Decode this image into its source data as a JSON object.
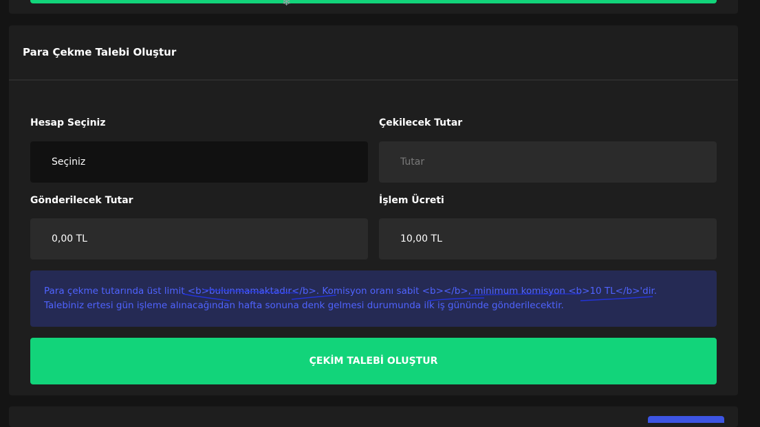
{
  "top": {
    "icon": "snowflake-icon",
    "snowflake_glyph": "❄"
  },
  "withdraw_form": {
    "title": "Para Çekme Talebi Oluştur",
    "account_label": "Hesap Seçiniz",
    "account_value": "Seçiniz",
    "amount_label": "Çekilecek Tutar",
    "amount_placeholder": "Tutar",
    "sent_amount_label": "Gönderilecek Tutar",
    "sent_amount_value": "0,00 TL",
    "fee_label": "İşlem Ücreti",
    "fee_value": "10,00 TL",
    "info_line1": "Para çekme tutarında üst limit <b>bulunmamaktadır</b>. Komisyon oranı sabit <b></b>, minimum komisyon <b>10 TL</b>'dir.",
    "info_line2": "Talebiniz ertesi gün işleme alınacağından hafta sonuna denk gelmesi durumunda ilk iş gününde gönderilecektir.",
    "submit_label": "ÇEKİM TALEBİ OLUŞTUR"
  },
  "colors": {
    "accent_green": "#12d47a",
    "info_bg": "#252a54",
    "info_text": "#4f63ff",
    "card_bg": "#1e1e1e",
    "page_bg": "#141414"
  }
}
